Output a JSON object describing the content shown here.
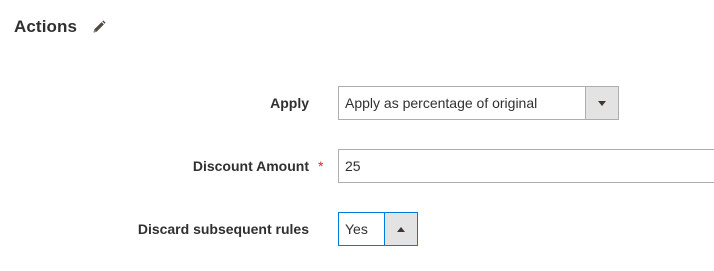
{
  "section": {
    "title": "Actions",
    "edit_icon": "pencil-icon"
  },
  "fields": {
    "apply": {
      "label": "Apply",
      "selected": "Apply as percentage of original",
      "arrow_icon": "chevron-down-icon"
    },
    "discount_amount": {
      "label": "Discount Amount",
      "required_marker": "*",
      "value": "25"
    },
    "discard_subsequent_rules": {
      "label": "Discard subsequent rules",
      "selected": "Yes",
      "arrow_icon": "chevron-up-icon",
      "focused": true
    }
  },
  "colors": {
    "required": "#e22626",
    "focus_border": "#007bdb",
    "border": "#adadad",
    "select_button_bg": "#e3e3e3"
  }
}
